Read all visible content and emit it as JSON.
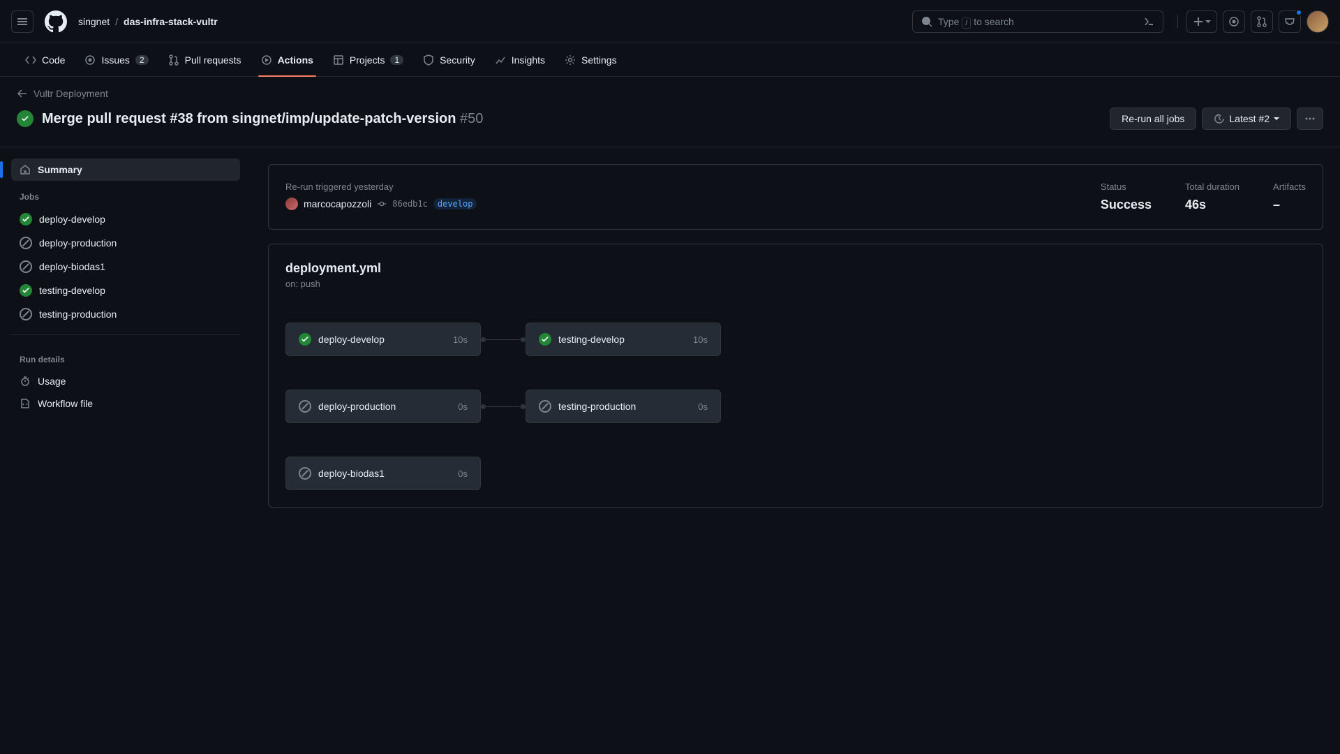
{
  "breadcrumb": {
    "owner": "singnet",
    "repo": "das-infra-stack-vultr"
  },
  "search": {
    "prefix": "Type ",
    "key": "/",
    "suffix": " to search"
  },
  "nav": {
    "code": "Code",
    "issues": "Issues",
    "issues_count": "2",
    "prs": "Pull requests",
    "actions": "Actions",
    "projects": "Projects",
    "projects_count": "1",
    "security": "Security",
    "insights": "Insights",
    "settings": "Settings"
  },
  "back_link": "Vultr Deployment",
  "run": {
    "title": "Merge pull request #38 from singnet/imp/update-patch-version",
    "number": "#50",
    "rerun_btn": "Re-run all jobs",
    "latest_btn": "Latest #2"
  },
  "sidebar": {
    "summary": "Summary",
    "jobs_label": "Jobs",
    "jobs": [
      {
        "name": "deploy-develop",
        "status": "success"
      },
      {
        "name": "deploy-production",
        "status": "skipped"
      },
      {
        "name": "deploy-biodas1",
        "status": "skipped"
      },
      {
        "name": "testing-develop",
        "status": "success"
      },
      {
        "name": "testing-production",
        "status": "skipped"
      }
    ],
    "run_details_label": "Run details",
    "usage": "Usage",
    "workflow_file": "Workflow file"
  },
  "summary": {
    "triggered_label": "Re-run triggered yesterday",
    "user": "marcocapozzoli",
    "sha": "86edb1c",
    "branch": "develop",
    "status_label": "Status",
    "status_value": "Success",
    "duration_label": "Total duration",
    "duration_value": "46s",
    "artifacts_label": "Artifacts",
    "artifacts_value": "–"
  },
  "workflow": {
    "file": "deployment.yml",
    "trigger": "on: push",
    "jobs": [
      [
        {
          "name": "deploy-develop",
          "time": "10s",
          "status": "success"
        },
        {
          "name": "testing-develop",
          "time": "10s",
          "status": "success"
        }
      ],
      [
        {
          "name": "deploy-production",
          "time": "0s",
          "status": "skipped"
        },
        {
          "name": "testing-production",
          "time": "0s",
          "status": "skipped"
        }
      ],
      [
        {
          "name": "deploy-biodas1",
          "time": "0s",
          "status": "skipped"
        }
      ]
    ]
  }
}
